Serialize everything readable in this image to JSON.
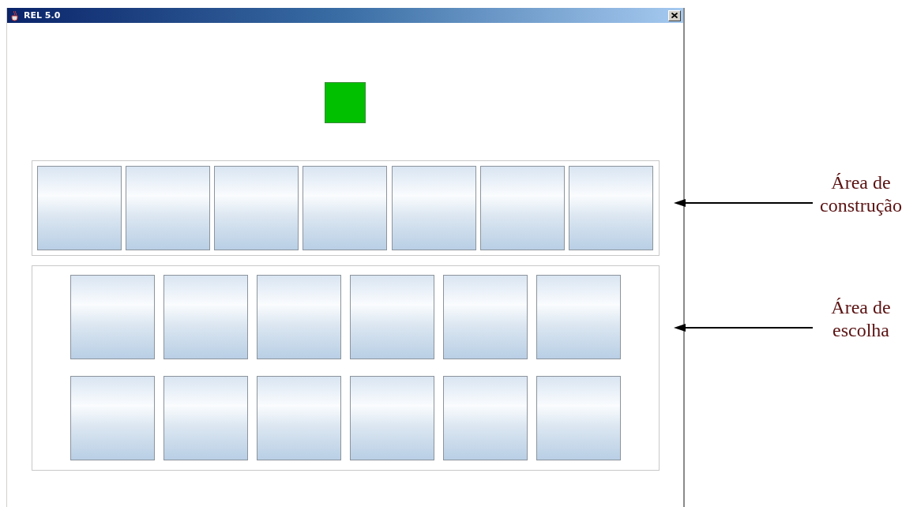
{
  "window": {
    "title": "REL 5.0"
  },
  "indicator": {
    "color": "#00c000"
  },
  "construction_area": {
    "slots": [
      {
        "kind": "blank"
      },
      {
        "kind": "blank"
      },
      {
        "kind": "blank"
      },
      {
        "kind": "blank"
      },
      {
        "kind": "blank"
      },
      {
        "kind": "blank"
      },
      {
        "kind": "blank"
      }
    ]
  },
  "choice_area": {
    "rows": [
      {
        "slots": [
          {
            "kind": "blank"
          },
          {
            "kind": "blank"
          },
          {
            "kind": "blank"
          },
          {
            "kind": "blank"
          },
          {
            "kind": "blank"
          },
          {
            "kind": "blank"
          }
        ]
      },
      {
        "slots": [
          {
            "kind": "blank"
          },
          {
            "kind": "blank"
          },
          {
            "kind": "blank"
          },
          {
            "kind": "blank"
          },
          {
            "kind": "blank"
          },
          {
            "kind": "blank"
          }
        ]
      }
    ]
  },
  "annotations": [
    {
      "text": "Área de construção"
    },
    {
      "text": "Área de escolha"
    }
  ]
}
